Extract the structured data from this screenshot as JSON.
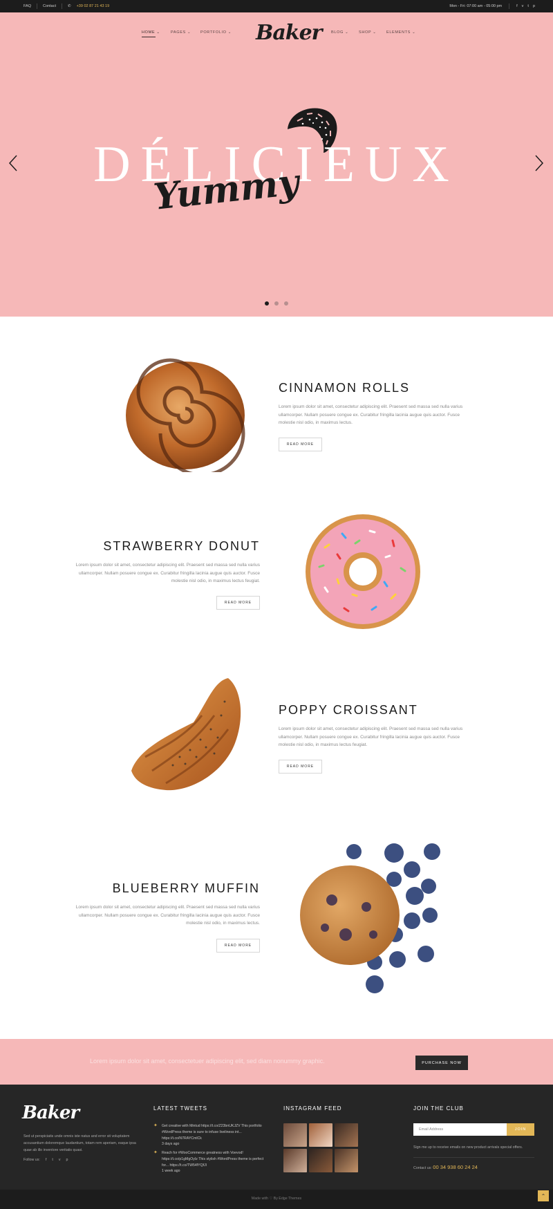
{
  "topbar": {
    "faq": "FAQ",
    "contact": "Contact",
    "phone": "+39 02 87 21 43 19",
    "hours": "Mon - Fri: 07:00 am - 05:00 pm",
    "social_icons": [
      "facebook-icon",
      "vimeo-icon",
      "twitter-icon",
      "pinterest-icon"
    ]
  },
  "nav": {
    "items": [
      "HOME",
      "PAGES",
      "PORTFOLIO",
      "BLOG",
      "SHOP",
      "ELEMENTS"
    ],
    "logo": "Baker"
  },
  "hero": {
    "title": "DÉLICIEUX",
    "script": "Yummy",
    "slide_count": 3,
    "active_slide": 1
  },
  "products": [
    {
      "title": "CINNAMON ROLLS",
      "text": "Lorem ipsum dolor sit amet, consectetur adipiscing elit. Praesent sed massa sed nulla varius ullamcorper. Nullam posuere congue ex. Curabitur fringilla lacinia augue quis auctor. Fusce molestie nisl odio, in maximus lectus.",
      "button": "READ MORE"
    },
    {
      "title": "STRAWBERRY DONUT",
      "text": "Lorem ipsum dolor sit amet, consectetur adipiscing elit. Praesent sed massa sed nulla varius ullamcorper. Nullam posuere congue ex. Curabitur fringilla lacinia augue quis auctor. Fusce molestie nisl odio, in maximus lectus feugiat.",
      "button": "READ MORE"
    },
    {
      "title": "POPPY CROISSANT",
      "text": "Lorem ipsum dolor sit amet, consectetur adipiscing elit. Praesent sed massa sed nulla varius ullamcorper. Nullam posuere congue ex. Curabitur fringilla lacinia augue quis auctor. Fusce molestie nisl odio, in maximus lectus feugiat.",
      "button": "READ MORE"
    },
    {
      "title": "BLUEBERRY MUFFIN",
      "text": "Lorem ipsum dolor sit amet, consectetur adipiscing elit. Praesent sed massa sed nulla varius ullamcorper. Nullam posuere congue ex. Curabitur fringilla lacinia augue quis auctor. Fusce molestie nisl odio, in maximus lectus.",
      "button": "READ MORE"
    }
  ],
  "promo": {
    "text": "Lorem ipsum dolor sit amet, consectetuer adipiscing elit, sed diam nonummy graphic.",
    "button": "PURCHASE NOW"
  },
  "footer": {
    "logo": "Baker",
    "about": "Sed ut perspiciatis unde omnis iste natus and error sit voluptatem accusantium doloremque laudantium, totam rem aperiam, eaque ipsa quae ab illo inventore veritatis quasi.",
    "follow_label": "Follow us:",
    "tweets_heading": "LATEST TWEETS",
    "tweets": [
      {
        "text": "Get creative with Mintud https://t.co/Z23bnUKJZV This portfolio #WordPress theme is sure to infuse liveliness int... https://t.co/N7RAYCmlCk",
        "time": "3 days ago"
      },
      {
        "text": "Reach for #WooCommerce greatness with Voevod! https://t.co/p1gMgOyIz This stylish #WordPress theme is perfect for... https://t.co/TW54fYQfJl",
        "time": "1 week ago"
      }
    ],
    "instagram_heading": "INSTAGRAM FEED",
    "club_heading": "JOIN THE CLUB",
    "email_placeholder": "Email Address",
    "join_label": "JOIN",
    "signup_text": "Sign me up to receive emails on new product arrivals special offers.",
    "contact_label": "Contact us:",
    "contact_number": "00 34 938 60 24 24",
    "made_with": "Made with",
    "by": "By Edge Themes"
  },
  "colors": {
    "pink": "#f6b8b8",
    "gold": "#e2b757",
    "dark": "#262626"
  }
}
